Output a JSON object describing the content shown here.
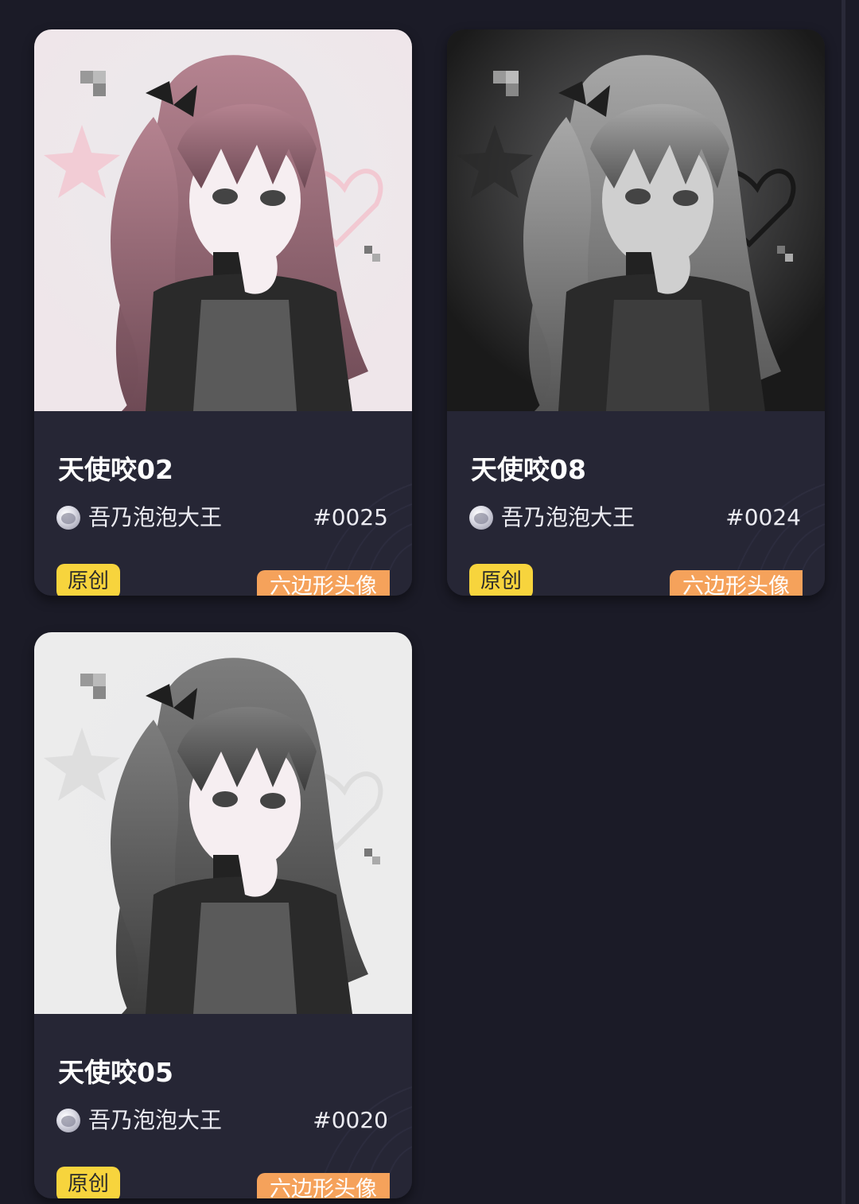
{
  "cards": [
    {
      "title": "天使咬02",
      "creator": "吾乃泡泡大王",
      "serial": "#0025",
      "tag_original": "原创",
      "tag_type": "六边形头像",
      "palette": {
        "bg": "#efe6ea",
        "hair": "#b58390",
        "hair_dark": "#6e4a55",
        "accent": "#f3c0cc"
      }
    },
    {
      "title": "天使咬08",
      "creator": "吾乃泡泡大王",
      "serial": "#0024",
      "tag_original": "原创",
      "tag_type": "六边形头像",
      "palette": {
        "bg": "#1a1a1a",
        "hair": "#a8a8a8",
        "hair_dark": "#555555",
        "accent": "#3a3a3a"
      }
    },
    {
      "title": "天使咬05",
      "creator": "吾乃泡泡大王",
      "serial": "#0020",
      "tag_original": "原创",
      "tag_type": "六边形头像",
      "palette": {
        "bg": "#ececec",
        "hair": "#7d7d7d",
        "hair_dark": "#3c3c3c",
        "accent": "#d9d9d9"
      }
    }
  ]
}
